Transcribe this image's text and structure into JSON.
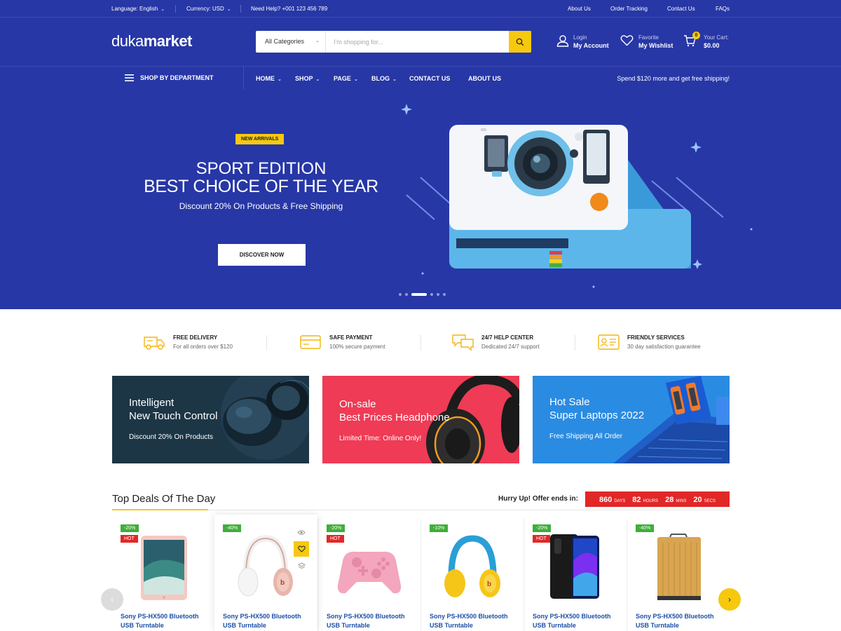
{
  "topbar": {
    "language": "Language: English",
    "currency": "Currency: USD",
    "help": "Need Help? +001 123 456 789",
    "links": [
      "About Us",
      "Order Tracking",
      "Contact Us",
      "FAQs"
    ]
  },
  "header": {
    "logo_a": "duka",
    "logo_b": "market",
    "search_category": "All Categories",
    "search_placeholder": "I'm shopping for...",
    "account_top": "Login",
    "account_bottom": "My Account",
    "wishlist_top": "Favorite",
    "wishlist_bottom": "My Wishlist",
    "cart_top": "Your Cart:",
    "cart_bottom": "$0.00",
    "cart_count": "0"
  },
  "nav": {
    "department": "SHOP BY DEPARTMENT",
    "items": [
      "HOME",
      "SHOP",
      "PAGE",
      "BLOG",
      "CONTACT US",
      "ABOUT US"
    ],
    "promo": "Spend $120 more and get free shipping!"
  },
  "hero": {
    "badge": "NEW ARRIVALS",
    "title_line1": "SPORT EDITION",
    "title_line2": "BEST CHOICE OF THE YEAR",
    "subtitle": "Discount 20% On Products & Free Shipping",
    "button": "DISCOVER NOW",
    "slide_count": 6,
    "active_slide": 3
  },
  "features": [
    {
      "title": "FREE DELIVERY",
      "text": "For all orders over $120",
      "icon": "truck-icon"
    },
    {
      "title": "SAFE PAYMENT",
      "text": "100% secure payment",
      "icon": "credit-card-icon"
    },
    {
      "title": "24/7 HELP CENTER",
      "text": "Dedicated 24/7 support",
      "icon": "chat-bubbles-icon"
    },
    {
      "title": "FRIENDLY SERVICES",
      "text": "30 day satisfaction guarantee",
      "icon": "id-card-icon"
    }
  ],
  "banners": [
    {
      "line1": "Intelligent",
      "line2": "New Touch Control",
      "line3": "Discount  20% On Products"
    },
    {
      "line1": "On-sale",
      "line2": "Best Prices Headphone",
      "line3": "Limited Time: Online Only!"
    },
    {
      "line1": "Hot Sale",
      "line2": "Super Laptops 2022",
      "line3": "Free Shipping All Order"
    }
  ],
  "deals": {
    "title": "Top Deals Of The Day",
    "hurry": "Hurry Up! Offer ends in:",
    "countdown": {
      "days": "860",
      "days_label": "DAYS",
      "hours": "82",
      "hours_label": "HOURS",
      "mins": "28",
      "mins_label": "MINS",
      "secs": "20",
      "secs_label": "SECS"
    },
    "hot_label": "HOT",
    "products": [
      {
        "discount": "-20%",
        "hot": true,
        "name": "Sony PS-HX500 Bluetooth USB Turntable"
      },
      {
        "discount": "-40%",
        "hot": false,
        "name": "Sony PS-HX500 Bluetooth USB Turntable"
      },
      {
        "discount": "-20%",
        "hot": true,
        "name": "Sony PS-HX500 Bluetooth USB Turntable"
      },
      {
        "discount": "-10%",
        "hot": false,
        "name": "Sony PS-HX500 Bluetooth USB Turntable"
      },
      {
        "discount": "-20%",
        "hot": true,
        "name": "Sony PS-HX500 Bluetooth USB Turntable"
      },
      {
        "discount": "-40%",
        "hot": false,
        "name": "Sony PS-HX500 Bluetooth USB Turntable"
      }
    ]
  },
  "colors": {
    "brand_blue": "#2737a6",
    "accent_yellow": "#f6c90f",
    "sale_red": "#e22727",
    "discount_green": "#3fae3a",
    "link_blue": "#1d4fa8"
  }
}
